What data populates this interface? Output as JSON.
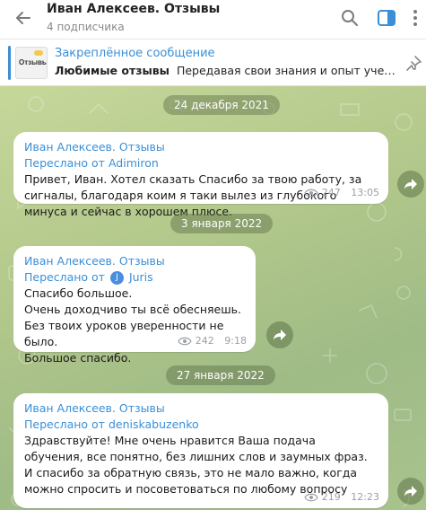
{
  "header": {
    "title": "Иван Алексеев. Отзывы",
    "subtitle": "4 подписчика",
    "icons": {
      "back": "arrow-left-icon",
      "search": "search-icon",
      "sidebar": "sidebar-icon",
      "menu": "more-vert-icon"
    }
  },
  "pinned": {
    "label": "Закреплённое сообщение",
    "bold_text": "Любимые отзывы",
    "text": "Передавая свои знания и опыт учени...",
    "thumb_text": "Отзывы",
    "icon": "pin-icon"
  },
  "accent_color": "#3a8fd6",
  "messages": [
    {
      "date": "24 декабря 2021",
      "channel": "Иван Алексеев. Отзывы",
      "forwarded_prefix": "Переслано от",
      "forwarded_from": "Adimiron",
      "text": "Привет, Иван. Хотел сказать Спасибо за твою работу, за сигналы, благодаря коим я таки вылез из глубокого минуса и сейчас в хорошем плюсе.",
      "views": "247",
      "time": "13:05"
    },
    {
      "date": "3 января 2022",
      "channel": "Иван Алексеев. Отзывы",
      "forwarded_prefix": "Переслано от",
      "forwarded_avatar": "J",
      "forwarded_from": "Juris",
      "lines": [
        "Спасибо большое.",
        "Очень доходчиво ты всё обесняешь.",
        "Без твоих уроков уверенности не было.",
        "Большое спасибо."
      ],
      "views": "242",
      "time": "9:18"
    },
    {
      "date": "27 января 2022",
      "channel": "Иван Алексеев. Отзывы",
      "forwarded_prefix": "Переслано от",
      "forwarded_from": "deniskabuzenko",
      "text": "Здравствуйте! Мне очень нравится Ваша подача обучения, все понятно, без лишних слов и заумных фраз. И спасибо за обратную связь, это не мало важно, когда можно спросить и посоветоваться по любому вопросу",
      "views": "219",
      "time": "12:23"
    }
  ]
}
